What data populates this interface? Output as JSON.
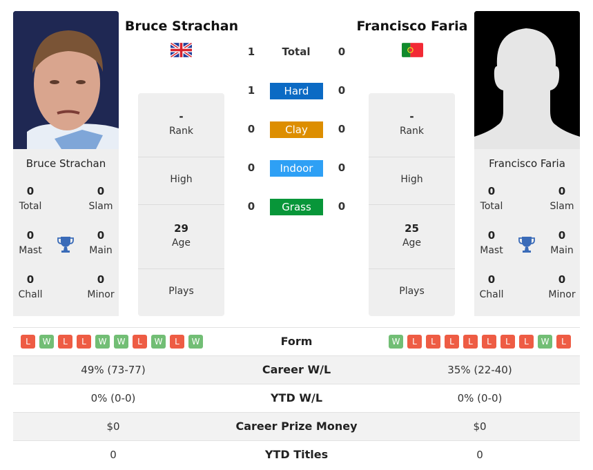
{
  "players": {
    "left": {
      "name": "Bruce Strachan",
      "country": "Great Britain",
      "flag_icon": "uk-flag-icon",
      "photo": "player-photo",
      "titles": {
        "total": "0",
        "slam": "0",
        "mast": "0",
        "main": "0",
        "chall": "0",
        "minor": "0"
      },
      "info": {
        "rank": "-",
        "high": "",
        "age": "29",
        "plays": ""
      },
      "form": [
        "L",
        "W",
        "L",
        "L",
        "W",
        "W",
        "L",
        "W",
        "L",
        "W"
      ],
      "career_wl": "49% (73-77)",
      "ytd_wl": "0% (0-0)",
      "prize_money": "$0",
      "ytd_titles": "0"
    },
    "right": {
      "name": "Francisco Faria",
      "country": "Portugal",
      "flag_icon": "portugal-flag-icon",
      "photo": "silhouette-placeholder",
      "titles": {
        "total": "0",
        "slam": "0",
        "mast": "0",
        "main": "0",
        "chall": "0",
        "minor": "0"
      },
      "info": {
        "rank": "-",
        "high": "",
        "age": "25",
        "plays": ""
      },
      "form": [
        "W",
        "L",
        "L",
        "L",
        "L",
        "L",
        "L",
        "L",
        "W",
        "L"
      ],
      "career_wl": "35% (22-40)",
      "ytd_wl": "0% (0-0)",
      "prize_money": "$0",
      "ytd_titles": "0"
    }
  },
  "labels": {
    "total": "Total",
    "slam": "Slam",
    "mast": "Mast",
    "main": "Main",
    "chall": "Chall",
    "minor": "Minor",
    "rank": "Rank",
    "high": "High",
    "age": "Age",
    "plays": "Plays",
    "form": "Form",
    "career_wl": "Career W/L",
    "ytd_wl": "YTD W/L",
    "prize_money": "Career Prize Money",
    "ytd_titles": "YTD Titles"
  },
  "h2h": {
    "total": {
      "label": "Total",
      "left": "1",
      "right": "0"
    },
    "surfaces": [
      {
        "label": "Hard",
        "left": "1",
        "right": "0",
        "color": "#0b6ac4"
      },
      {
        "label": "Clay",
        "left": "0",
        "right": "0",
        "color": "#dd8e00"
      },
      {
        "label": "Indoor",
        "left": "0",
        "right": "0",
        "color": "#2ea0f5"
      },
      {
        "label": "Grass",
        "left": "0",
        "right": "0",
        "color": "#089639"
      }
    ]
  },
  "colors": {
    "win": "#72be75",
    "loss": "#ee5c44",
    "trophy": "#3a6bb8"
  }
}
